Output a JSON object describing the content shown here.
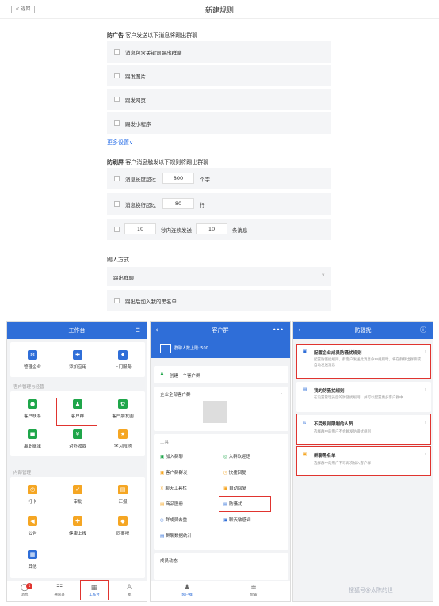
{
  "header": {
    "back_label": "< 返回",
    "title": "新建规则"
  },
  "ad": {
    "heading_bold": "防广告",
    "heading": "客户发送以下消息将踢出群聊",
    "options": [
      "消息包含关键词踢出群聊",
      "踢发图片",
      "踢发网页",
      "踢发小程序"
    ]
  },
  "more_settings": "更多设置∨",
  "flood": {
    "heading_bold": "防刷屏",
    "heading": "客户消息触发以下规则将踢出群聊",
    "length_label": "消息长度超过",
    "length_value": "800",
    "length_unit": "个字",
    "lines_label": "消息换行超过",
    "lines_value": "80",
    "lines_unit": "行",
    "burst_seconds": "10",
    "burst_mid": "秒内连续发送",
    "burst_count": "10",
    "burst_unit": "条消息"
  },
  "kick": {
    "heading": "踢人方式",
    "select_value": "踢出群聊",
    "blacklist_label": "踢出后加入我的黑名单"
  },
  "phone1": {
    "title": "工作台",
    "top_items": [
      "管理企业",
      "添加应用",
      "上门服务"
    ],
    "section1": "客户管理与经营",
    "row1": [
      "客户联系",
      "客户群",
      "客户朋友圈"
    ],
    "row2": [
      "离职继承",
      "对外收款",
      "学习园地"
    ],
    "section2": "内部管理",
    "row3": [
      "打卡",
      "审批",
      "汇报"
    ],
    "row4": [
      "公告",
      "健康上报",
      "同事吧"
    ],
    "row5": [
      "其他"
    ],
    "tabs": [
      "消息",
      "通讯录",
      "工作台",
      "我"
    ],
    "badge": "1"
  },
  "phone2": {
    "title": "客户群",
    "info": "群聊人数上限: 500",
    "create": "创建一个客户群",
    "all_groups": "企业全部客户群",
    "tools_label": "工具",
    "tools": [
      "加入群聊",
      "入群欢迎语",
      "客户群群发",
      "快捷回复",
      "聊天工具栏",
      "自动回复",
      "商品图册",
      "防骚扰",
      "群成员去重",
      "聊天敏感词",
      "群聊数据统计"
    ],
    "members_label": "成员动态",
    "tabs": [
      "客户群",
      "配置"
    ]
  },
  "phone3": {
    "title": "防骚扰",
    "items": [
      {
        "title": "配置企业成员防骚扰规则",
        "desc": "配置防骚扰规则，群客户发送此消息命中规则时，将在群聊出群聊或自动发送消息"
      },
      {
        "title": "我的防骚扰规则",
        "desc": "在设置管理员后的防骚扰规则，并可以配置更多客户群中"
      },
      {
        "title": "不受规则限制的人员",
        "desc": "选择群中的用户不会触发防骚扰规则"
      },
      {
        "title": "群聊黑名单",
        "desc": "选择群中的用户不可再次加入客户群"
      }
    ],
    "watermark": "搜狐号@太陈的世"
  },
  "colors": {
    "accent": "#2f6ed8",
    "highlight": "#e0342f"
  }
}
